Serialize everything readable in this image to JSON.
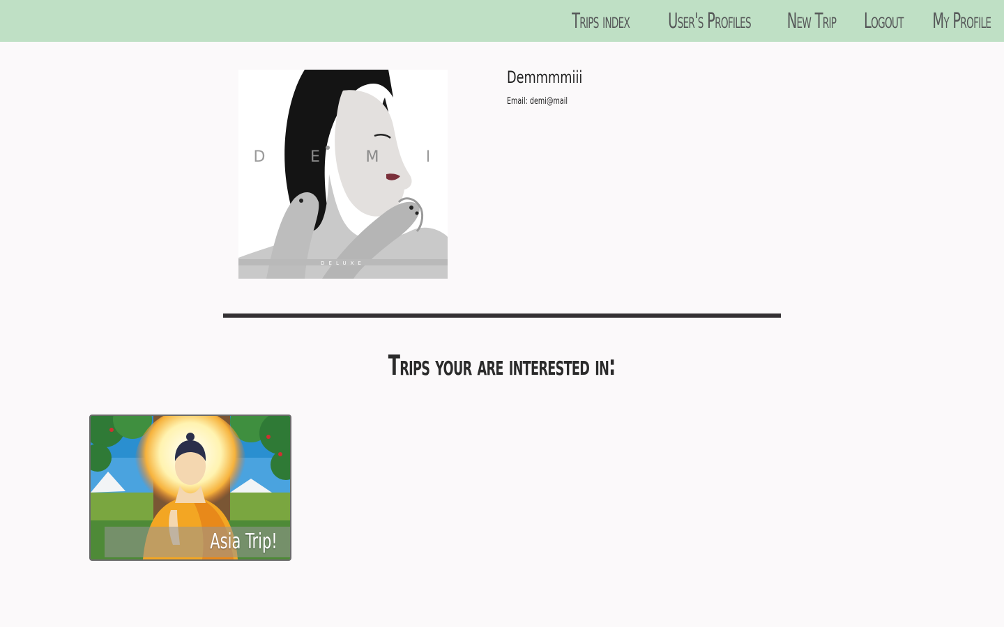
{
  "nav": {
    "items": [
      {
        "label": "Trips index"
      },
      {
        "label": "User's Profiles"
      },
      {
        "label": "New Trip"
      },
      {
        "label": "Logout"
      },
      {
        "label": "My Profile"
      }
    ]
  },
  "profile": {
    "avatar_letters": [
      "D",
      "E",
      "M",
      "I"
    ],
    "avatar_banner": "DELUXE",
    "name": "Demmmmiii",
    "email": "Email: demi@mail"
  },
  "interested": {
    "title": "Trips your are interested in:",
    "trips": [
      {
        "title": "Asia Trip!"
      }
    ]
  },
  "colors": {
    "topbar": "#bfe0c5",
    "background": "#fbf9fa",
    "divider": "#333032"
  }
}
